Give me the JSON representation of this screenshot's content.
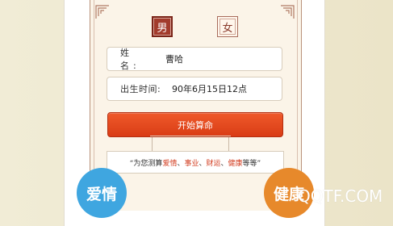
{
  "gender": {
    "male_label": "男",
    "female_label": "女",
    "selected": "男"
  },
  "form": {
    "name_label": "姓　名:",
    "name_value": "曹哈",
    "birth_label": "出生时间:",
    "birth_value": "90年6月15日12点"
  },
  "start_button_label": "开始算命",
  "description": {
    "prefix": "“为您测算",
    "love": "爱情",
    "sep1": "、",
    "career": "事业",
    "sep2": "、",
    "wealth": "财运",
    "sep3": "、",
    "health": "健康",
    "suffix": "等等”"
  },
  "categories": {
    "love": "爱情",
    "health": "健康"
  },
  "watermark": "QQTF.COM",
  "colors": {
    "accent_red": "#d93c16",
    "male_selected": "#a23b2c",
    "love_circle": "#3fa6e0",
    "health_circle": "#e7892b"
  }
}
